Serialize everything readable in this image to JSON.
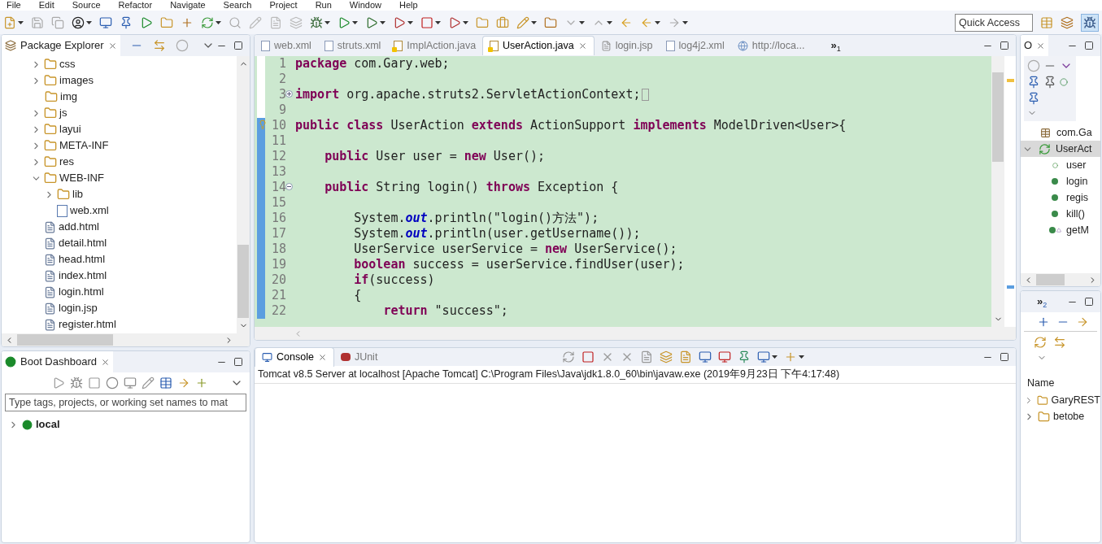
{
  "menu": [
    "File",
    "Edit",
    "Source",
    "Refactor",
    "Navigate",
    "Search",
    "Project",
    "Run",
    "Window",
    "Help"
  ],
  "quick_access": {
    "placeholder": "Quick Access"
  },
  "package_explorer": {
    "title": "Package Explorer",
    "tree": [
      {
        "label": "css",
        "kind": "folder",
        "expanded": false
      },
      {
        "label": "images",
        "kind": "folder",
        "expanded": false
      },
      {
        "label": "img",
        "kind": "folder"
      },
      {
        "label": "js",
        "kind": "folder",
        "expanded": false
      },
      {
        "label": "layui",
        "kind": "folder",
        "expanded": false
      },
      {
        "label": "META-INF",
        "kind": "folder",
        "expanded": false
      },
      {
        "label": "res",
        "kind": "folder",
        "expanded": false
      },
      {
        "label": "WEB-INF",
        "kind": "folder",
        "expanded": true,
        "children": [
          {
            "label": "lib",
            "kind": "folder",
            "expanded": false
          },
          {
            "label": "web.xml",
            "kind": "xml"
          }
        ]
      },
      {
        "label": "add.html",
        "kind": "file"
      },
      {
        "label": "detail.html",
        "kind": "file"
      },
      {
        "label": "head.html",
        "kind": "file"
      },
      {
        "label": "index.html",
        "kind": "file"
      },
      {
        "label": "login.html",
        "kind": "file"
      },
      {
        "label": "login.jsp",
        "kind": "file"
      },
      {
        "label": "register.html",
        "kind": "file"
      }
    ]
  },
  "boot_dashboard": {
    "title": "Boot Dashboard",
    "filter": {
      "placeholder": "Type tags, projects, or working set names to mat"
    },
    "items": [
      {
        "label": "local",
        "expanded": false
      }
    ]
  },
  "editor": {
    "tabs": [
      {
        "label": "web.xml",
        "kind": "xml",
        "selected": false
      },
      {
        "label": "struts.xml",
        "kind": "xml",
        "selected": false
      },
      {
        "label": "ImplAction.java",
        "kind": "java",
        "selected": false
      },
      {
        "label": "UserAction.java",
        "kind": "java",
        "selected": true
      },
      {
        "label": "login.jsp",
        "kind": "jsp",
        "selected": false
      },
      {
        "label": "log4j2.xml",
        "kind": "xml",
        "selected": false
      },
      {
        "label": "http://loca...",
        "kind": "web",
        "selected": false
      }
    ],
    "overflow": "»",
    "overflow_count": "1",
    "lines": [
      {
        "number": "1",
        "changed": false,
        "code": "**package** com.Gary.web;"
      },
      {
        "number": "2",
        "changed": false
      },
      {
        "number": "3",
        "changed": false,
        "folded": true,
        "code": "**import** org.apache.struts2.ServletActionContext;"
      },
      {
        "number": "9",
        "changed": false
      },
      {
        "number": "10",
        "changed": true,
        "warning": true,
        "code": "**public** **class** UserAction **extends** ActionSupport **implements** ModelDriven<User>{"
      },
      {
        "number": "11",
        "changed": true
      },
      {
        "number": "12",
        "changed": true,
        "code": "    **public** User user = **new** User();"
      },
      {
        "number": "13",
        "changed": true
      },
      {
        "number": "14",
        "changed": true,
        "folded": false,
        "code": "    **public** String login() **throws** Exception {"
      },
      {
        "number": "15",
        "changed": true
      },
      {
        "number": "16",
        "changed": true,
        "code": "        System.*out*.println(\"login()方法\");"
      },
      {
        "number": "17",
        "changed": true,
        "code": "        System.*out*.println(user.getUsername());"
      },
      {
        "number": "18",
        "changed": true,
        "code": "        UserService userService = **new** UserService();"
      },
      {
        "number": "19",
        "changed": true,
        "code": "        **boolean** success = userService.findUser(user);"
      },
      {
        "number": "20",
        "changed": true,
        "code": "        **if**(success)"
      },
      {
        "number": "21",
        "changed": true,
        "code": "        {"
      },
      {
        "number": "22",
        "changed": true,
        "code": "            **return** \"success\";"
      }
    ]
  },
  "console": {
    "tabs": [
      {
        "label": "Console",
        "kind": "console",
        "selected": true
      },
      {
        "label": "JUnit",
        "kind": "junit",
        "selected": false
      }
    ],
    "process": "Tomcat v8.5 Server at localhost [Apache Tomcat] C:\\Program Files\\Java\\jdk1.8.0_60\\bin\\javaw.exe (2019年9月23日 下午4:17:48)"
  },
  "outline": {
    "title": "O",
    "tree": [
      {
        "label": "com.Ga",
        "kind": "package",
        "selected": false
      },
      {
        "label": "UserAct",
        "kind": "class",
        "selected": true,
        "expanded": true,
        "children": [
          {
            "label": "user",
            "kind": "field",
            "selected": false
          },
          {
            "label": "login",
            "kind": "method",
            "selected": false
          },
          {
            "label": "regis",
            "kind": "method",
            "selected": false
          },
          {
            "label": "kill()",
            "kind": "method",
            "selected": false
          },
          {
            "label": "getM",
            "kind": "override",
            "selected": false
          }
        ]
      }
    ]
  },
  "servers": {
    "overflow": "»",
    "overflow_count": "2",
    "column": "Name",
    "items": [
      {
        "label": "GaryREST",
        "expanded": false
      },
      {
        "label": "betobe",
        "expanded": false
      }
    ]
  }
}
